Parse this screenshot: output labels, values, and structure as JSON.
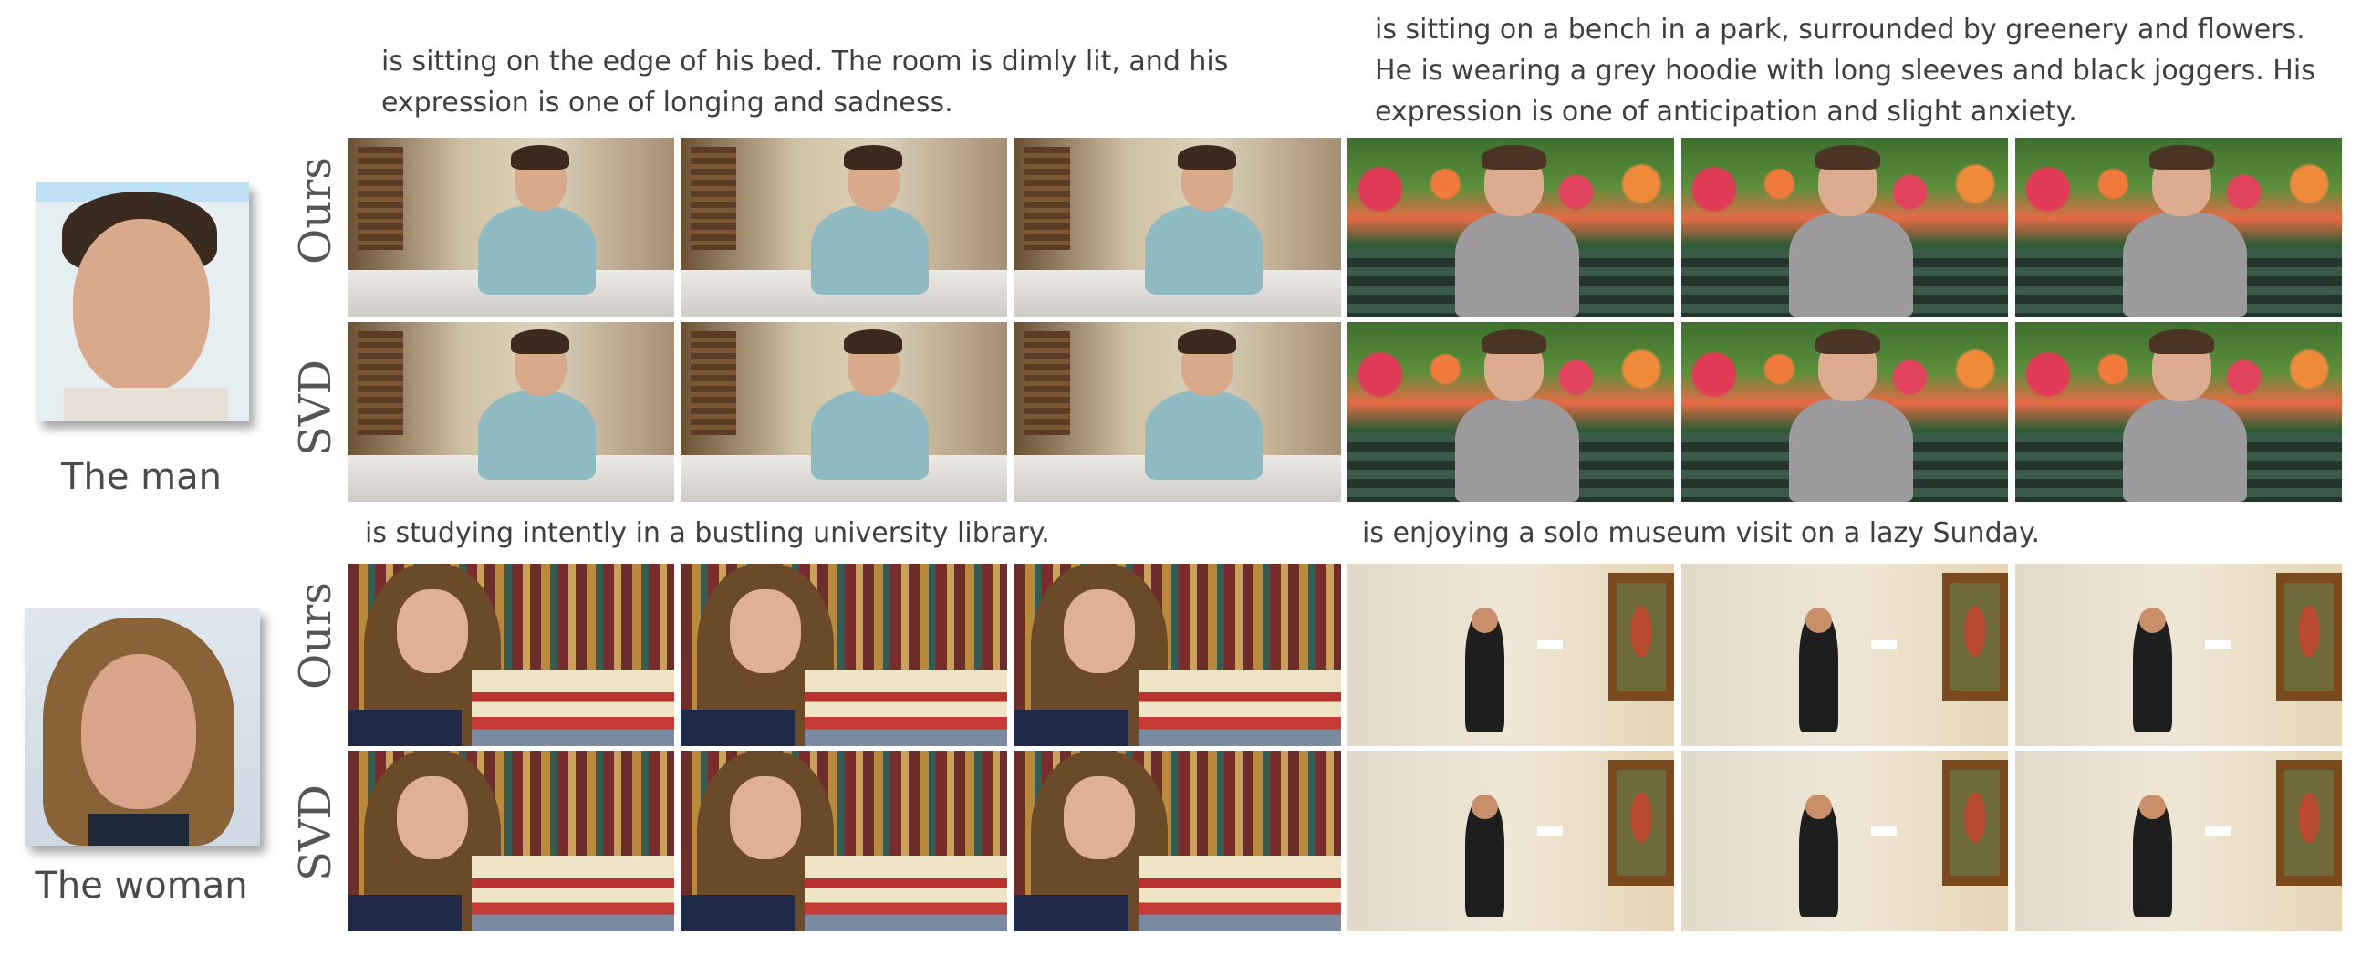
{
  "references": [
    {
      "caption": "The man"
    },
    {
      "caption": "The woman"
    }
  ],
  "row_labels": {
    "ours": "Ours",
    "svd": "SVD"
  },
  "prompts": {
    "man_left_line1": "is sitting on the edge of his bed. The room is dimly lit, and his",
    "man_left_line2": "expression is one of longing and sadness.",
    "man_right_line1": "is sitting on a bench in a park, surrounded by greenery and flowers.",
    "man_right_line2": "He is wearing a grey hoodie with long sleeves and black joggers. His",
    "man_right_line3": "expression is one of anticipation and slight anxiety.",
    "woman_left": "is studying intently in a bustling university library.",
    "woman_right": "is enjoying a solo museum visit on a lazy Sunday."
  }
}
